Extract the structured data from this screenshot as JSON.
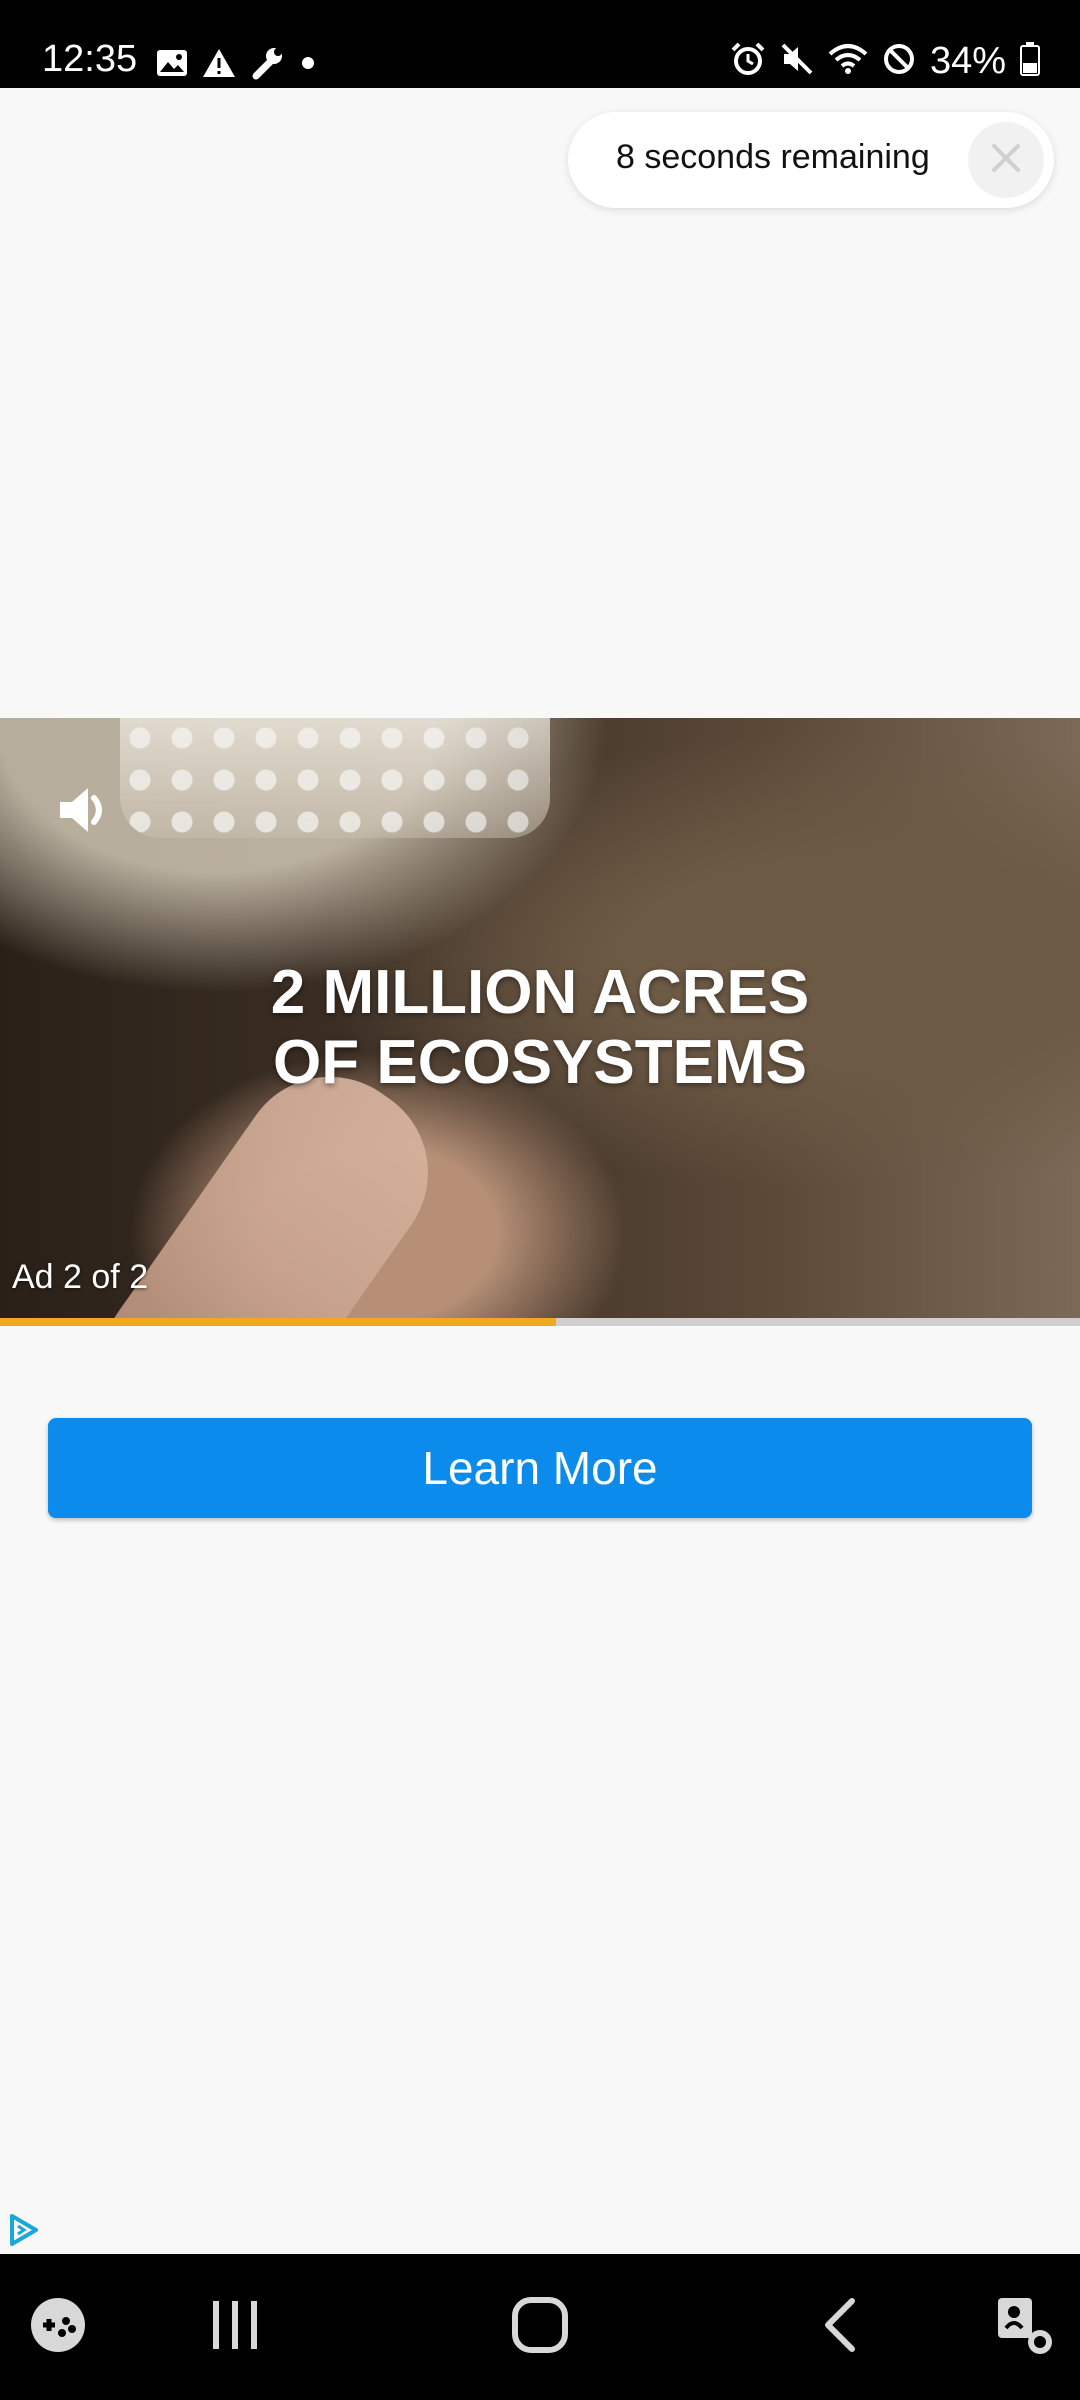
{
  "status_bar": {
    "time": "12:35",
    "battery": "34%",
    "left_icons": [
      "image-icon",
      "warning-icon",
      "wrench-icon",
      "dot-icon"
    ],
    "right_icons": [
      "alarm-icon",
      "mute-icon",
      "wifi-icon",
      "dnd-icon",
      "battery-icon"
    ]
  },
  "ad": {
    "countdown_text": "8 seconds remaining",
    "video_headline_line1": "2 MILLION ACRES",
    "video_headline_line2": "OF ECOSYSTEMS",
    "ad_counter": "Ad 2 of 2",
    "progress_fraction": 0.515,
    "cta_label": "Learn More"
  },
  "colors": {
    "cta": "#0b8ced",
    "progress": "#f3a822",
    "adchoices": "#1aa8d8"
  },
  "nav_bar": {
    "items": [
      "game-launcher-icon",
      "recent-apps-icon",
      "home-icon",
      "back-icon",
      "accessibility-icon"
    ]
  }
}
